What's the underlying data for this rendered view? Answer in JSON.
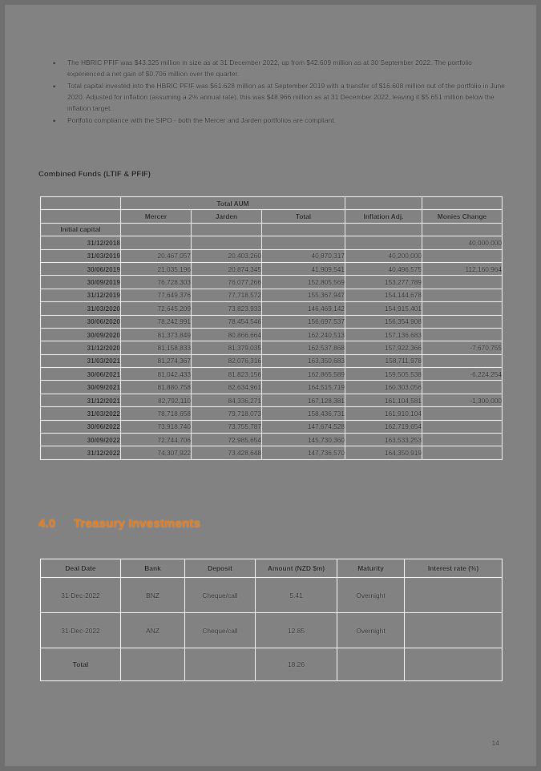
{
  "document": {
    "page_number": "14",
    "accent_color": "#ee7b11",
    "background_color": "#828282"
  },
  "bullets": [
    {
      "marker": "•",
      "text": "The HBRIC PFIF was $43.325 million in size as at 31 December 2022, up from $42.609 million as at 30 September 2022. The portfolio experienced a net gain of $0.706 million over the quarter."
    },
    {
      "marker": "•",
      "text": "Total capital invested into the HBRIC PFIF was $61.628 million as at September 2019 with a transfer of $16.608 million out of the portfolio in June 2020. Adjusted for inflation (assuming a 2% annual rate), this was $48.966 million as at 31 December 2022, leaving it $5.651 million below the inflation target."
    },
    {
      "marker": "•",
      "text": "Portfolio compliance with the SIPO - both the Mercer and Jarden portfolios are compliant."
    }
  ],
  "combined_funds": {
    "label": "Combined Funds (LTIF & PFIF)",
    "group_header": "Total AUM",
    "columns": [
      "",
      "Mercer",
      "Jarden",
      "Total",
      "Inflation Adj.",
      "Monies Change"
    ],
    "initial_capital_label": "Initial capital",
    "rows": [
      {
        "date": "31/12/2018",
        "mercer": "",
        "jarden": "",
        "total": "",
        "inflation_adj": "",
        "monies_change": "40,000,000"
      },
      {
        "date": "31/03/2019",
        "mercer": "20,467,057",
        "jarden": "20,403,260",
        "total": "40,870,317",
        "inflation_adj": "40,200,000",
        "monies_change": ""
      },
      {
        "date": "30/06/2019",
        "mercer": "21,035,196",
        "jarden": "20,874,345",
        "total": "41,909,541",
        "inflation_adj": "40,496,575",
        "monies_change": "112,160,964"
      },
      {
        "date": "30/09/2019",
        "mercer": "76,728,303",
        "jarden": "76,077,266",
        "total": "152,805,569",
        "inflation_adj": "153,277,789",
        "monies_change": ""
      },
      {
        "date": "31/12/2019",
        "mercer": "77,649,376",
        "jarden": "77,718,572",
        "total": "155,367,947",
        "inflation_adj": "154,144,678",
        "monies_change": ""
      },
      {
        "date": "31/03/2020",
        "mercer": "72,645,209",
        "jarden": "73,823,933",
        "total": "146,469,142",
        "inflation_adj": "154,915,401",
        "monies_change": ""
      },
      {
        "date": "30/06/2020",
        "mercer": "78,242,991",
        "jarden": "78,454,546",
        "total": "156,697,537",
        "inflation_adj": "156,354,908",
        "monies_change": ""
      },
      {
        "date": "30/09/2020",
        "mercer": "81,373,849",
        "jarden": "80,866,664",
        "total": "162,240,513",
        "inflation_adj": "157,136,683",
        "monies_change": ""
      },
      {
        "date": "31/12/2020",
        "mercer": "81,158,833",
        "jarden": "81,379,035",
        "total": "162,537,868",
        "inflation_adj": "157,922,366",
        "monies_change": "-7,670,755"
      },
      {
        "date": "31/03/2021",
        "mercer": "81,274,367",
        "jarden": "82,076,316",
        "total": "163,350,683",
        "inflation_adj": "158,711,978",
        "monies_change": ""
      },
      {
        "date": "30/06/2021",
        "mercer": "81,042,433",
        "jarden": "81,823,156",
        "total": "162,865,589",
        "inflation_adj": "159,505,538",
        "monies_change": "-6,224,254"
      },
      {
        "date": "30/09/2021",
        "mercer": "81,880,758",
        "jarden": "82,634,961",
        "total": "164,515,719",
        "inflation_adj": "160,303,056",
        "monies_change": ""
      },
      {
        "date": "31/12/2021",
        "mercer": "82,792,110",
        "jarden": "84,336,271",
        "total": "167,128,381",
        "inflation_adj": "161,104,581",
        "monies_change": "-1,300,000"
      },
      {
        "date": "31/03/2022",
        "mercer": "78,718,658",
        "jarden": "79,718,073",
        "total": "158,436,731",
        "inflation_adj": "161,910,104",
        "monies_change": ""
      },
      {
        "date": "30/06/2022",
        "mercer": "73,918,740",
        "jarden": "73,755,787",
        "total": "147,674,528",
        "inflation_adj": "162,719,654",
        "monies_change": ""
      },
      {
        "date": "30/09/2022",
        "mercer": "72,744,706",
        "jarden": "72,985,654",
        "total": "145,730,360",
        "inflation_adj": "163,533,253",
        "monies_change": ""
      },
      {
        "date": "31/12/2022",
        "mercer": "74,307,922",
        "jarden": "73,428,648",
        "total": "147,736,570",
        "inflation_adj": "164,350,919",
        "monies_change": ""
      }
    ]
  },
  "treasury": {
    "heading_number": "4.0",
    "heading_title": "Treasury Investments",
    "columns": [
      "Deal Date",
      "Bank",
      "Deposit",
      "Amount (NZD $m)",
      "Maturity",
      "Interest rate (%)"
    ],
    "rows": [
      {
        "deal_date": "31-Dec-2022",
        "bank": "BNZ",
        "deposit": "Cheque/call",
        "amount": "5.41",
        "maturity": "Overnight",
        "interest_rate": ""
      },
      {
        "deal_date": "31-Dec-2022",
        "bank": "ANZ",
        "deposit": "Cheque/call",
        "amount": "12.85",
        "maturity": "Overnight",
        "interest_rate": ""
      }
    ],
    "total_row": {
      "label": "Total",
      "bank": "",
      "deposit": "",
      "amount": "18.26",
      "maturity": "",
      "interest_rate": ""
    }
  }
}
